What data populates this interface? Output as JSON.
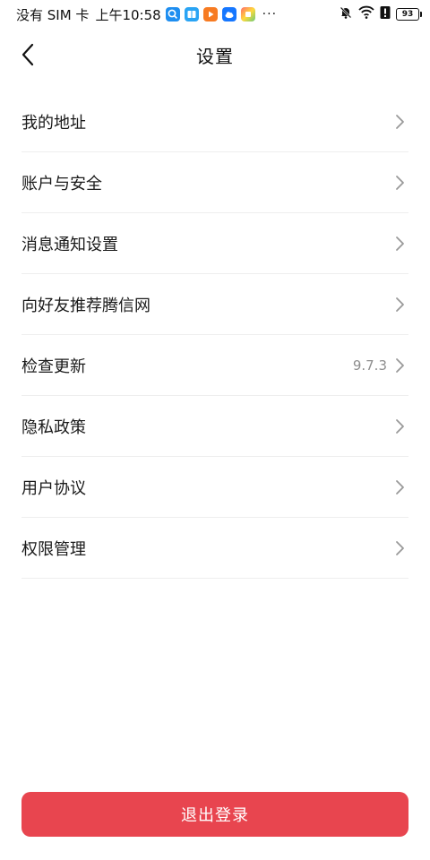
{
  "status_bar": {
    "carrier_text": "没有 SIM 卡",
    "time": "上午10:58",
    "more": "···",
    "battery_level": "93",
    "notification_icons": [
      "search-app-icon",
      "book-app-icon",
      "video-app-icon",
      "cloud-app-icon",
      "puzzle-app-icon"
    ],
    "indicator_icons": [
      "mute-bell-icon",
      "wifi-icon",
      "alert-icon",
      "battery-icon"
    ]
  },
  "header": {
    "title": "设置",
    "back_icon": "chevron-left-icon"
  },
  "settings": {
    "items": [
      {
        "label": "我的地址",
        "value": ""
      },
      {
        "label": "账户与安全",
        "value": ""
      },
      {
        "label": "消息通知设置",
        "value": ""
      },
      {
        "label": "向好友推荐腾信网",
        "value": ""
      },
      {
        "label": "检查更新",
        "value": "9.7.3"
      },
      {
        "label": "隐私政策",
        "value": ""
      },
      {
        "label": "用户协议",
        "value": ""
      },
      {
        "label": "权限管理",
        "value": ""
      }
    ]
  },
  "footer": {
    "logout_label": "退出登录"
  },
  "colors": {
    "accent": "#e8454f",
    "divider": "#eeeeee",
    "secondary_text": "#8e8e8e"
  }
}
